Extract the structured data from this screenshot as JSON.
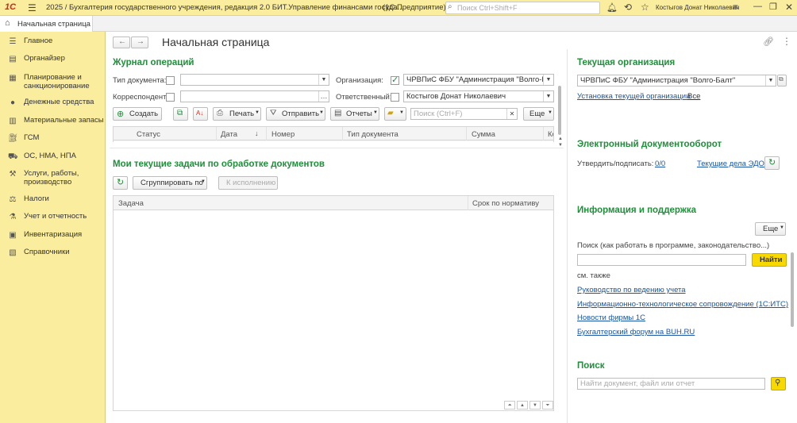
{
  "titlebar": {
    "logo": "1С",
    "title": "2025 / Бухгалтерия государственного учреждения, редакция 2.0 БИТ.Управление финансами госуда...",
    "platform": "(1С:Предприятие)",
    "search_placeholder": "Поиск Ctrl+Shift+F",
    "user": "Костыгов Донат Николаевич"
  },
  "tabs": [
    {
      "label": "Начальная страница"
    }
  ],
  "sidebar": {
    "items": [
      {
        "label": "Главное",
        "icon": "menu-icon"
      },
      {
        "label": "Органайзер",
        "icon": "organizer-icon"
      },
      {
        "label": "Планирование и\nсанкционирование",
        "icon": "planning-icon"
      },
      {
        "label": "Денежные средства",
        "icon": "money-icon"
      },
      {
        "label": "Материальные запасы",
        "icon": "inventory-icon"
      },
      {
        "label": "ГСМ",
        "icon": "fuel-icon"
      },
      {
        "label": "ОС, НМА, НПА",
        "icon": "assets-icon"
      },
      {
        "label": "Услуги, работы,\nпроизводство",
        "icon": "services-icon"
      },
      {
        "label": "Налоги",
        "icon": "taxes-icon"
      },
      {
        "label": "Учет и отчетность",
        "icon": "reports-icon"
      },
      {
        "label": "Инвентаризация",
        "icon": "inventory-check-icon"
      },
      {
        "label": "Справочники",
        "icon": "catalogs-icon"
      }
    ]
  },
  "page": {
    "title": "Начальная страница"
  },
  "journal": {
    "title": "Журнал операций",
    "doc_type_label": "Тип документа:",
    "doc_type_value": "",
    "org_label": "Организация:",
    "org_value": "ЧРВПиС ФБУ \"Администрация \"Волго-Балт\"",
    "correspondent_label": "Корреспондент:",
    "correspondent_value": "",
    "responsible_label": "Ответственный:",
    "responsible_value": "Костыгов Донат Николаевич",
    "create_btn": "Создать",
    "print_btn": "Печать",
    "send_btn": "Отправить",
    "reports_btn": "Отчеты",
    "search_placeholder": "Поиск (Ctrl+F)",
    "more_btn": "Еще",
    "columns": [
      "Статус",
      "Дата",
      "Номер",
      "Тип документа",
      "Сумма",
      "Ко"
    ]
  },
  "tasks": {
    "title": "Мои текущие задачи по обработке документов",
    "group_btn": "Сгруппировать по",
    "exec_btn": "К исполнению",
    "columns": [
      "Задача",
      "Срок по нормативу"
    ]
  },
  "org": {
    "title": "Текущая организация",
    "value": "ЧРВПиС ФБУ \"Администрация \"Волго-Балт\"",
    "set_link": "Установка текущей организации",
    "all_link": "Все"
  },
  "edo": {
    "title": "Электронный документооборот",
    "approve_label": "Утвердить/подписать:",
    "approve_value": "0/0",
    "current_link": "Текущие дела ЭДО"
  },
  "info": {
    "title": "Информация и поддержка",
    "more_btn": "Еще",
    "search_label": "Поиск (как работать в программе, законодательство...)",
    "find_btn": "Найти",
    "see_also": "см. также",
    "links": [
      "Руководство по ведению учета",
      "Информационно-технологическое сопровождение (1С:ИТС)",
      "Новости фирмы 1С",
      "Бухгалтерский форум на BUH.RU"
    ]
  },
  "search": {
    "title": "Поиск",
    "placeholder": "Найти документ, файл или отчет"
  },
  "colors": {
    "accent": "#1f8f3a",
    "sidebar_bg": "#fbed9e",
    "link": "#1a55a8",
    "find_btn": "#f7d900"
  }
}
